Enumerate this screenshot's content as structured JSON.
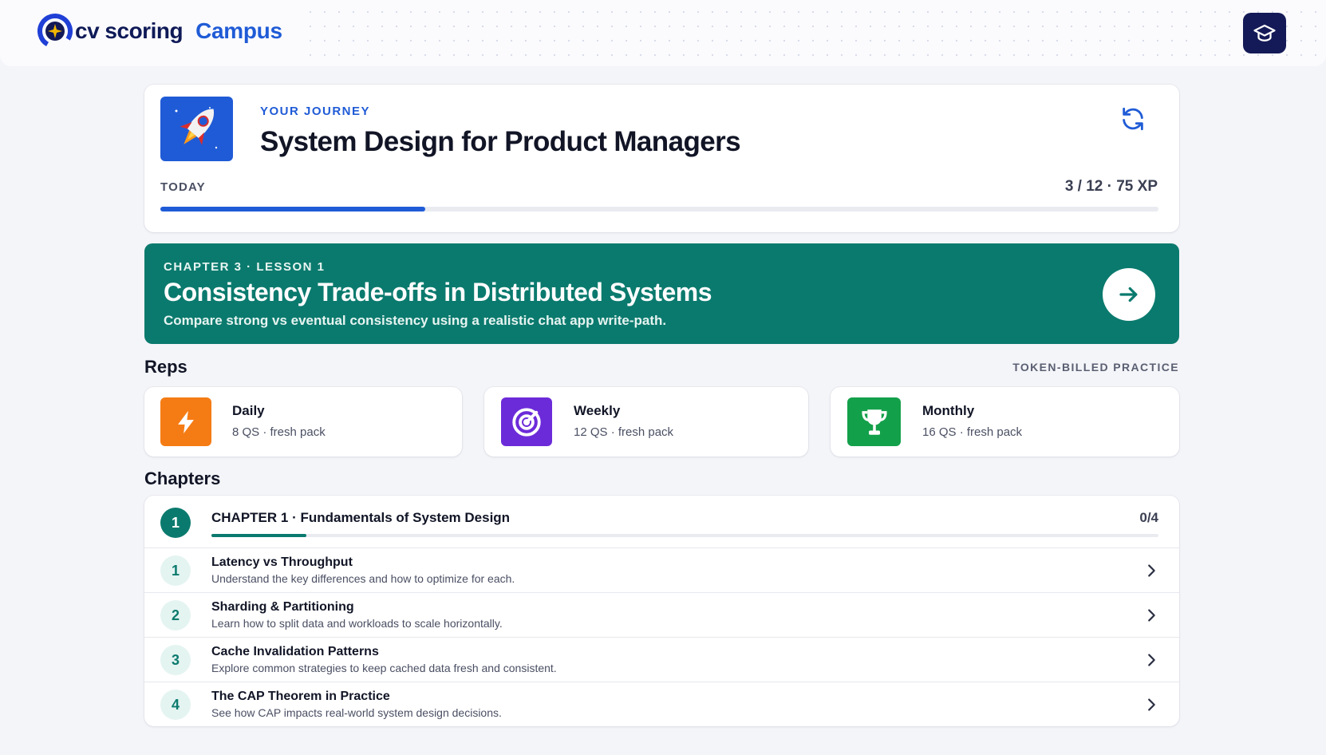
{
  "header": {
    "brand": "cv scoring",
    "product": "Campus",
    "profile_icon": "graduation-cap-icon"
  },
  "journey": {
    "kicker": "YOUR JOURNEY",
    "title": "System Design for Product Managers",
    "today_label": "TODAY",
    "stats": "3 / 12 · 75 XP",
    "progress": 0.265,
    "icon": "rocket-icon",
    "refresh_icon": "refresh-icon"
  },
  "current_lesson": {
    "kicker": "CHAPTER 3 · LESSON 1",
    "title": "Consistency Trade-offs in Distributed Systems",
    "subtitle": "Compare strong vs eventual consistency using a realistic chat app write-path.",
    "action_icon": "arrow-right-icon"
  },
  "reps": {
    "title": "Reps",
    "note": "TOKEN-BILLED PRACTICE",
    "items": [
      {
        "name": "Daily",
        "meta": "8 QS · fresh pack",
        "icon": "lightning-icon",
        "color": "#f57c14"
      },
      {
        "name": "Weekly",
        "meta": "12 QS · fresh pack",
        "icon": "target-icon",
        "color": "#6c2bd9"
      },
      {
        "name": "Monthly",
        "meta": "16 QS · fresh pack",
        "icon": "trophy-icon",
        "color": "#13a04a"
      }
    ]
  },
  "chapters": {
    "title": "Chapters",
    "chapter": {
      "number": "1",
      "title": "CHAPTER 1 · Fundamentals of System Design",
      "count": "0/4",
      "progress": 0.1
    },
    "lessons": [
      {
        "number": "1",
        "title": "Latency vs Throughput",
        "desc": "Understand the key differences and how to optimize for each."
      },
      {
        "number": "2",
        "title": "Sharding & Partitioning",
        "desc": "Learn how to split data and workloads to scale horizontally."
      },
      {
        "number": "3",
        "title": "Cache Invalidation Patterns",
        "desc": "Explore common strategies to keep cached data fresh and consistent."
      },
      {
        "number": "4",
        "title": "The CAP Theorem in Practice",
        "desc": "See how CAP impacts real-world system design decisions."
      }
    ]
  },
  "colors": {
    "brand_blue": "#1f5bd6",
    "navy": "#141a57",
    "teal": "#0b7a6e"
  }
}
